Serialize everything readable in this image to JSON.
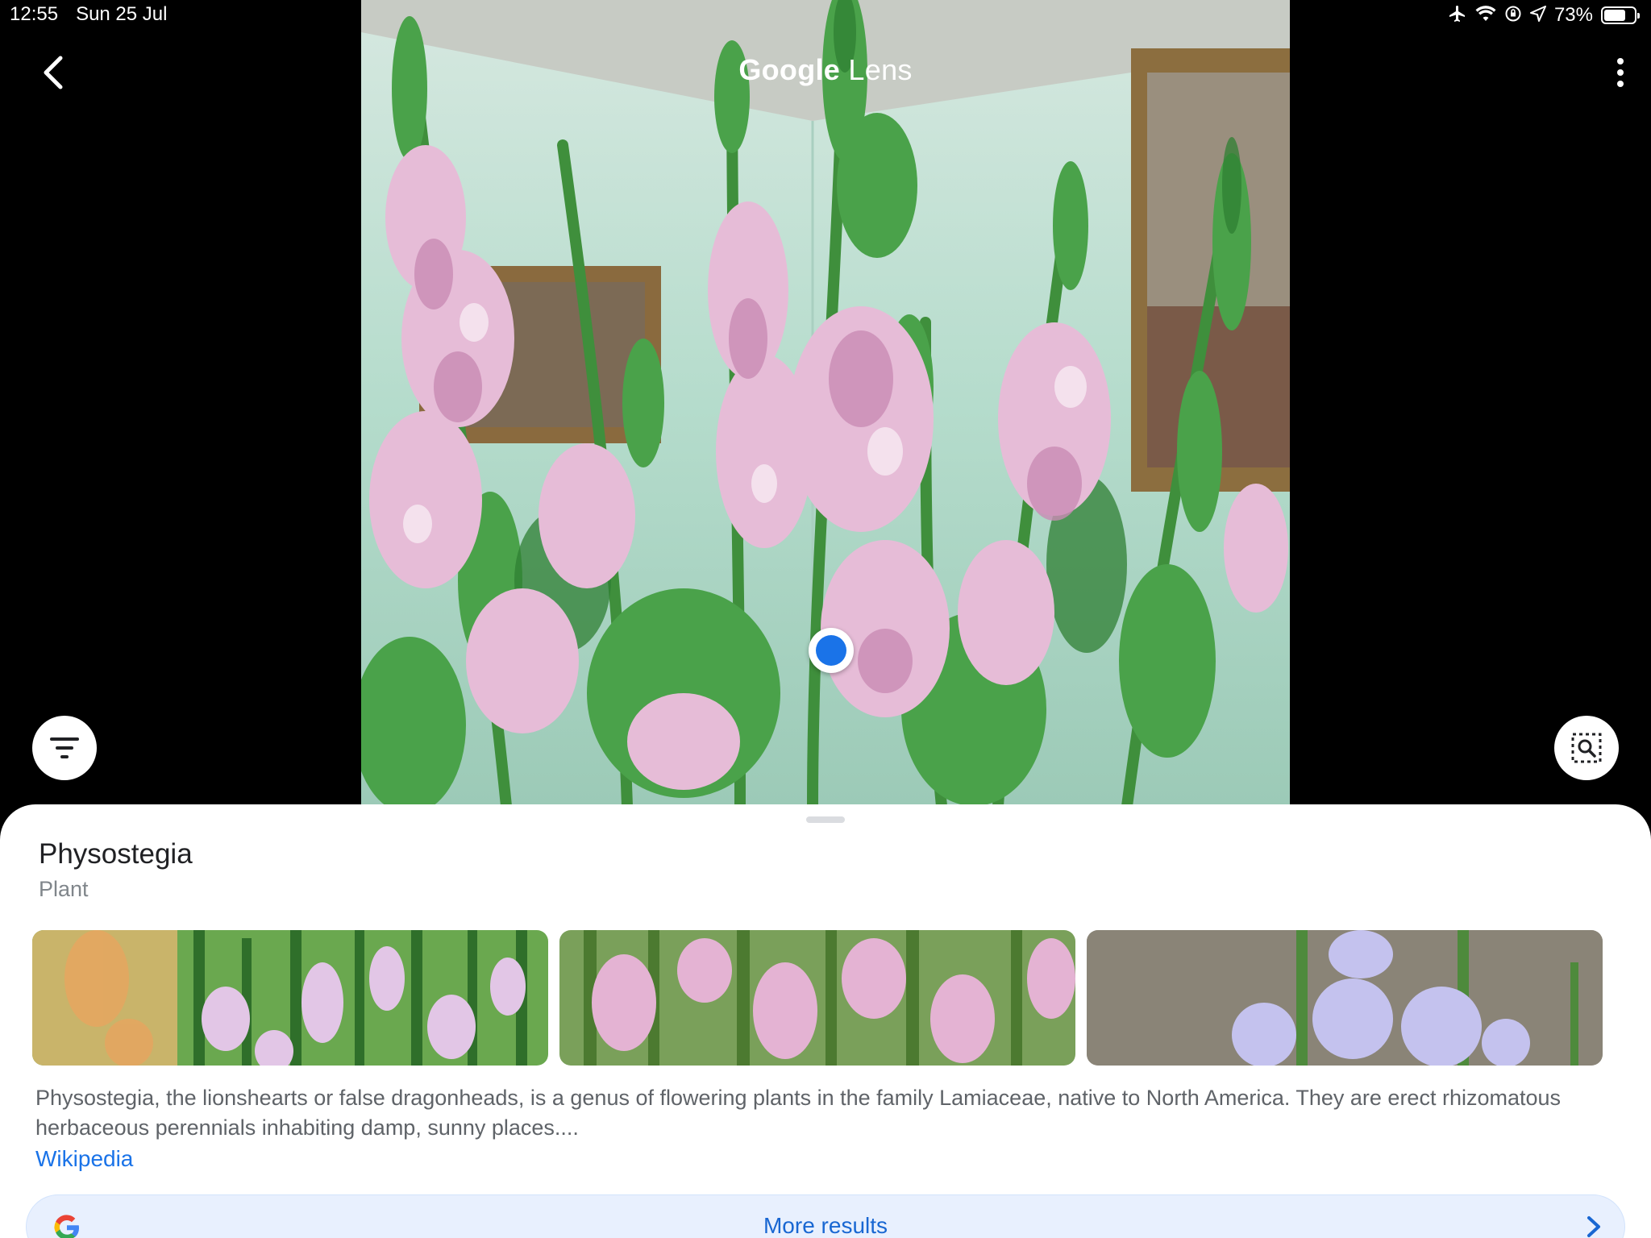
{
  "status_bar": {
    "time": "12:55",
    "date": "Sun 25 Jul",
    "battery": "73%",
    "battery_level": 0.73,
    "icons": [
      "airplane-icon",
      "wifi-icon",
      "rotation-lock-icon",
      "location-icon",
      "battery-icon"
    ]
  },
  "header": {
    "brand": "Google",
    "product": "Lens",
    "back_icon": "chevron-left-icon",
    "menu_icon": "more-vertical-icon"
  },
  "controls": {
    "filter_icon": "filter-icon",
    "select_icon": "image-search-icon",
    "focus_dot_color": "#1a73e8"
  },
  "result": {
    "title": "Physostegia",
    "subtitle": "Plant",
    "description": "Physostegia, the lionshearts or false dragonheads, is a genus of flowering plants in the family Lamiaceae, native to North America. They are erect rhizomatous herbaceous perennials inhabiting damp, sunny places....",
    "source": "Wikipedia",
    "images": [
      "pink-white-physostegia-spikes",
      "pink-physostegia-field",
      "lavender-physostegia-against-gravel"
    ]
  },
  "more_results": {
    "label": "More results",
    "icon": "google-g-icon",
    "chevron": "chevron-right-icon"
  },
  "colors": {
    "accent": "#1a73e8",
    "more_results_bg": "#e8f0fe",
    "sheet_bg": "#ffffff"
  }
}
